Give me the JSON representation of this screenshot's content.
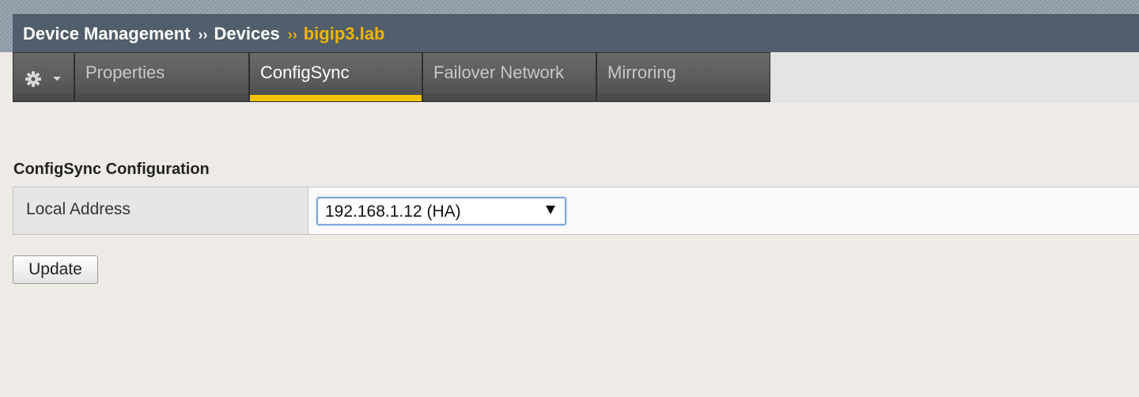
{
  "breadcrumb": {
    "items": [
      "Device Management",
      "Devices"
    ],
    "separator": "››",
    "current": "bigip3.lab"
  },
  "tabs": [
    {
      "label": "Properties",
      "active": false
    },
    {
      "label": "ConfigSync",
      "active": true
    },
    {
      "label": "Failover Network",
      "active": false
    },
    {
      "label": "Mirroring",
      "active": false
    }
  ],
  "section": {
    "title": "ConfigSync Configuration",
    "rows": [
      {
        "label": "Local Address",
        "value": "192.168.1.12 (HA)"
      }
    ]
  },
  "actions": {
    "update_label": "Update"
  },
  "icons": {
    "settings_menu": "gear-icon",
    "settings_caret": "chevron-down-icon",
    "select_caret": "triangle-down-icon"
  },
  "colors": {
    "header_bg": "#515e6b",
    "accent": "#f2c400",
    "current_crumb": "#f0b400"
  }
}
